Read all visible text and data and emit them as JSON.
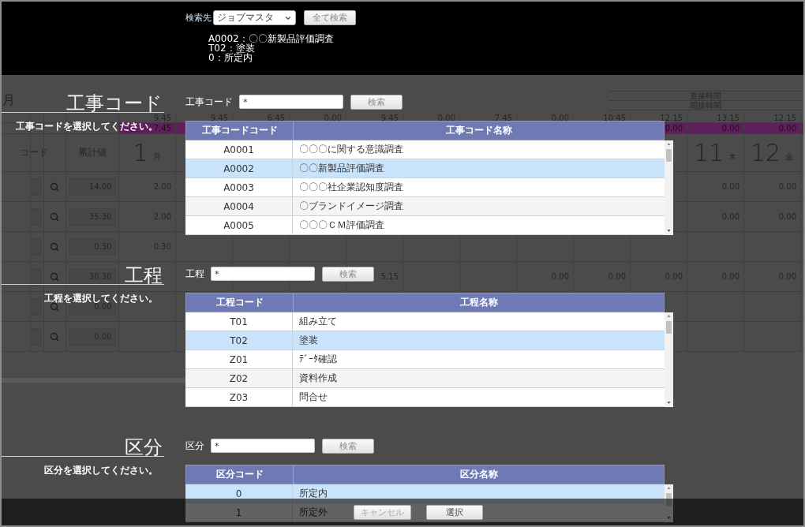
{
  "search_bar": {
    "label": "検索先",
    "select_value": "ジョブマスタ",
    "search_all_button": "全て検索"
  },
  "selection_summary": [
    "A0002：〇〇新製品評価調査",
    "T02：塗装",
    "0：所定内"
  ],
  "timesheet": {
    "month_label": "月",
    "time_labels": [
      "直接時間",
      "間接時間"
    ],
    "totals": [
      "9.45",
      "9.45",
      "6.45",
      "0.00",
      "9.45",
      "0.00",
      "7.45",
      "0.00",
      "10.45",
      "12.15",
      "13.15",
      "12.15"
    ],
    "overtime": {
      "first_day": "7.45",
      "last_days": [
        "0.00",
        "0.00",
        "0.00"
      ]
    },
    "code_header": "コード",
    "cumulative_header": "累計値",
    "first_day": {
      "day": "1",
      "weekday": "月"
    },
    "last_days": [
      {
        "day": "11",
        "weekday": "木"
      },
      {
        "day": "12",
        "weekday": "金"
      }
    ],
    "rows": [
      {
        "cumulative": "14.00",
        "first_day": "2.00",
        "last_days": [
          "0.00",
          "0.00"
        ]
      },
      {
        "cumulative": "35.30",
        "first_day": "2.00",
        "last_days": [
          "0.00",
          "0.00"
        ]
      },
      {
        "cumulative": "0.30",
        "first_day": "0.30"
      },
      {
        "cumulative": "30.30",
        "day_5": "5.15",
        "last_days": [
          "0.00",
          "0.00",
          "0.00",
          "0.00",
          "0.00"
        ]
      },
      {
        "cumulative": "0.00"
      },
      {
        "cumulative": "0.00"
      }
    ]
  },
  "sections": [
    {
      "heading": "工事コード",
      "prompt": "工事コードを選択してください。",
      "field_label": "工事コード",
      "field_value": "*",
      "search_button": "検索",
      "columns": [
        "工事コードコード",
        "工事コード名称"
      ],
      "rows": [
        {
          "code": "A0001",
          "name": "〇〇〇に関する意識調査",
          "selected": false
        },
        {
          "code": "A0002",
          "name": "〇〇新製品評価調査",
          "selected": true
        },
        {
          "code": "A0003",
          "name": "〇〇〇社企業認知度調査",
          "selected": false
        },
        {
          "code": "A0004",
          "name": "〇ブランドイメージ調査",
          "selected": false
        },
        {
          "code": "A0005",
          "name": "〇〇〇ＣＭ評価調査",
          "selected": false
        }
      ]
    },
    {
      "heading": "工程",
      "prompt": "工程を選択してください。",
      "field_label": "工程",
      "field_value": "*",
      "search_button": "検索",
      "columns": [
        "工程コード",
        "工程名称"
      ],
      "rows": [
        {
          "code": "T01",
          "name": "組み立て",
          "selected": false
        },
        {
          "code": "T02",
          "name": "塗装",
          "selected": true
        },
        {
          "code": "Z01",
          "name": "ﾃﾞｰﾀ確認",
          "selected": false
        },
        {
          "code": "Z02",
          "name": "資料作成",
          "selected": false
        },
        {
          "code": "Z03",
          "name": "問合せ",
          "selected": false
        }
      ]
    },
    {
      "heading": "区分",
      "prompt": "区分を選択してください。",
      "field_label": "区分",
      "field_value": "*",
      "search_button": "検索",
      "columns": [
        "区分コード",
        "区分名称"
      ],
      "rows": [
        {
          "code": "0",
          "name": "所定内",
          "selected": true
        },
        {
          "code": "1",
          "name": "所定外",
          "selected": false
        }
      ]
    }
  ],
  "footer": {
    "cancel_button": "キャンセル",
    "select_button": "選択"
  }
}
